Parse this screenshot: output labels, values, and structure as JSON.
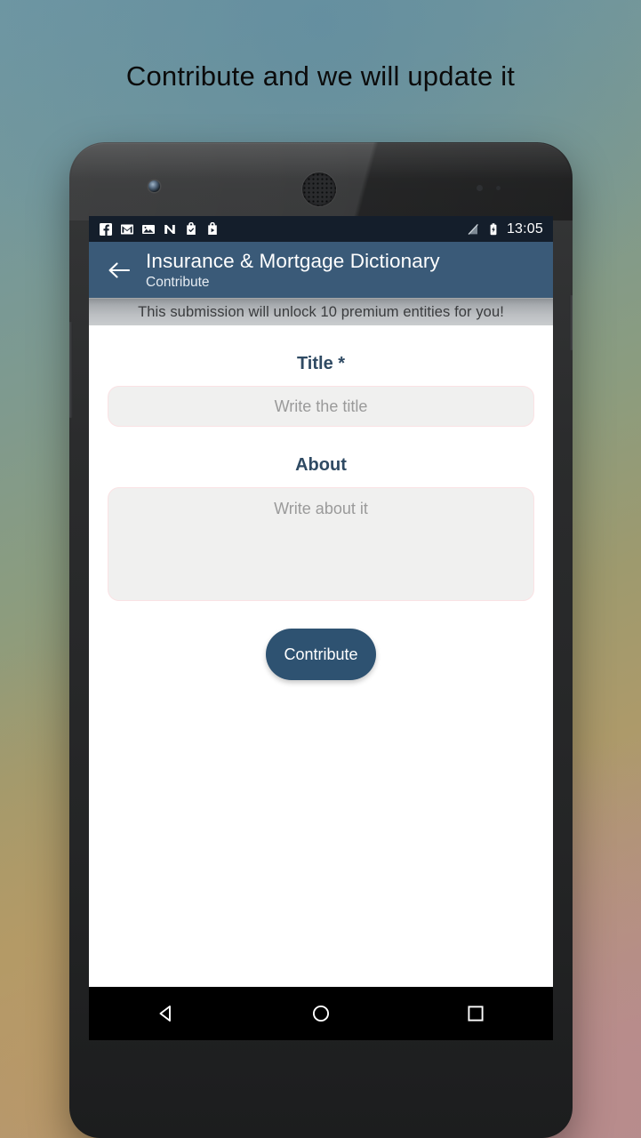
{
  "headline": "Contribute and we will update it",
  "status_bar": {
    "notification_icons": [
      {
        "name": "facebook-icon"
      },
      {
        "name": "gmail-icon"
      },
      {
        "name": "photos-icon"
      },
      {
        "name": "nova-launcher-icon"
      },
      {
        "name": "bag-check-icon"
      },
      {
        "name": "play-store-bag-icon"
      }
    ],
    "signal_icon": "no-signal-icon",
    "battery_icon": "battery-charging-icon",
    "clock": "13:05"
  },
  "app_bar": {
    "back_icon": "back-arrow-icon",
    "title": "Insurance & Mortgage Dictionary",
    "subtitle": "Contribute",
    "background_color": "#3a5a78"
  },
  "banner": {
    "text": "This submission will unlock 10 premium entities for you!"
  },
  "form": {
    "title_field": {
      "label": "Title *",
      "placeholder": "Write the title",
      "value": ""
    },
    "about_field": {
      "label": "About",
      "placeholder": "Write about it",
      "value": ""
    },
    "submit_button": {
      "label": "Contribute",
      "color": "#2e5271"
    }
  },
  "nav_bar": {
    "back": "nav-back-icon",
    "home": "nav-home-icon",
    "recents": "nav-recents-icon"
  },
  "colors": {
    "accent": "#3a5a78",
    "field_border": "#fae2e4",
    "field_fill": "#f0f0ef",
    "label": "#2f4a63"
  }
}
